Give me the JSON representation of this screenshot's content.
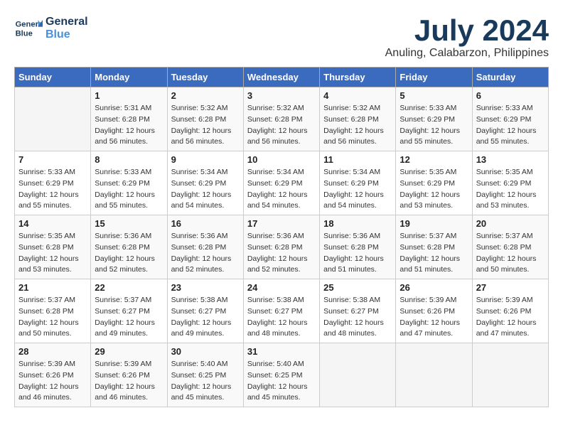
{
  "header": {
    "logo_line1": "General",
    "logo_line2": "Blue",
    "title": "July 2024",
    "subtitle": "Anuling, Calabarzon, Philippines"
  },
  "calendar": {
    "days_of_week": [
      "Sunday",
      "Monday",
      "Tuesday",
      "Wednesday",
      "Thursday",
      "Friday",
      "Saturday"
    ],
    "weeks": [
      [
        {
          "day": "",
          "info": ""
        },
        {
          "day": "1",
          "info": "Sunrise: 5:31 AM\nSunset: 6:28 PM\nDaylight: 12 hours\nand 56 minutes."
        },
        {
          "day": "2",
          "info": "Sunrise: 5:32 AM\nSunset: 6:28 PM\nDaylight: 12 hours\nand 56 minutes."
        },
        {
          "day": "3",
          "info": "Sunrise: 5:32 AM\nSunset: 6:28 PM\nDaylight: 12 hours\nand 56 minutes."
        },
        {
          "day": "4",
          "info": "Sunrise: 5:32 AM\nSunset: 6:28 PM\nDaylight: 12 hours\nand 56 minutes."
        },
        {
          "day": "5",
          "info": "Sunrise: 5:33 AM\nSunset: 6:29 PM\nDaylight: 12 hours\nand 55 minutes."
        },
        {
          "day": "6",
          "info": "Sunrise: 5:33 AM\nSunset: 6:29 PM\nDaylight: 12 hours\nand 55 minutes."
        }
      ],
      [
        {
          "day": "7",
          "info": "Sunrise: 5:33 AM\nSunset: 6:29 PM\nDaylight: 12 hours\nand 55 minutes."
        },
        {
          "day": "8",
          "info": "Sunrise: 5:33 AM\nSunset: 6:29 PM\nDaylight: 12 hours\nand 55 minutes."
        },
        {
          "day": "9",
          "info": "Sunrise: 5:34 AM\nSunset: 6:29 PM\nDaylight: 12 hours\nand 54 minutes."
        },
        {
          "day": "10",
          "info": "Sunrise: 5:34 AM\nSunset: 6:29 PM\nDaylight: 12 hours\nand 54 minutes."
        },
        {
          "day": "11",
          "info": "Sunrise: 5:34 AM\nSunset: 6:29 PM\nDaylight: 12 hours\nand 54 minutes."
        },
        {
          "day": "12",
          "info": "Sunrise: 5:35 AM\nSunset: 6:29 PM\nDaylight: 12 hours\nand 53 minutes."
        },
        {
          "day": "13",
          "info": "Sunrise: 5:35 AM\nSunset: 6:29 PM\nDaylight: 12 hours\nand 53 minutes."
        }
      ],
      [
        {
          "day": "14",
          "info": "Sunrise: 5:35 AM\nSunset: 6:28 PM\nDaylight: 12 hours\nand 53 minutes."
        },
        {
          "day": "15",
          "info": "Sunrise: 5:36 AM\nSunset: 6:28 PM\nDaylight: 12 hours\nand 52 minutes."
        },
        {
          "day": "16",
          "info": "Sunrise: 5:36 AM\nSunset: 6:28 PM\nDaylight: 12 hours\nand 52 minutes."
        },
        {
          "day": "17",
          "info": "Sunrise: 5:36 AM\nSunset: 6:28 PM\nDaylight: 12 hours\nand 52 minutes."
        },
        {
          "day": "18",
          "info": "Sunrise: 5:36 AM\nSunset: 6:28 PM\nDaylight: 12 hours\nand 51 minutes."
        },
        {
          "day": "19",
          "info": "Sunrise: 5:37 AM\nSunset: 6:28 PM\nDaylight: 12 hours\nand 51 minutes."
        },
        {
          "day": "20",
          "info": "Sunrise: 5:37 AM\nSunset: 6:28 PM\nDaylight: 12 hours\nand 50 minutes."
        }
      ],
      [
        {
          "day": "21",
          "info": "Sunrise: 5:37 AM\nSunset: 6:28 PM\nDaylight: 12 hours\nand 50 minutes."
        },
        {
          "day": "22",
          "info": "Sunrise: 5:37 AM\nSunset: 6:27 PM\nDaylight: 12 hours\nand 49 minutes."
        },
        {
          "day": "23",
          "info": "Sunrise: 5:38 AM\nSunset: 6:27 PM\nDaylight: 12 hours\nand 49 minutes."
        },
        {
          "day": "24",
          "info": "Sunrise: 5:38 AM\nSunset: 6:27 PM\nDaylight: 12 hours\nand 48 minutes."
        },
        {
          "day": "25",
          "info": "Sunrise: 5:38 AM\nSunset: 6:27 PM\nDaylight: 12 hours\nand 48 minutes."
        },
        {
          "day": "26",
          "info": "Sunrise: 5:39 AM\nSunset: 6:26 PM\nDaylight: 12 hours\nand 47 minutes."
        },
        {
          "day": "27",
          "info": "Sunrise: 5:39 AM\nSunset: 6:26 PM\nDaylight: 12 hours\nand 47 minutes."
        }
      ],
      [
        {
          "day": "28",
          "info": "Sunrise: 5:39 AM\nSunset: 6:26 PM\nDaylight: 12 hours\nand 46 minutes."
        },
        {
          "day": "29",
          "info": "Sunrise: 5:39 AM\nSunset: 6:26 PM\nDaylight: 12 hours\nand 46 minutes."
        },
        {
          "day": "30",
          "info": "Sunrise: 5:40 AM\nSunset: 6:25 PM\nDaylight: 12 hours\nand 45 minutes."
        },
        {
          "day": "31",
          "info": "Sunrise: 5:40 AM\nSunset: 6:25 PM\nDaylight: 12 hours\nand 45 minutes."
        },
        {
          "day": "",
          "info": ""
        },
        {
          "day": "",
          "info": ""
        },
        {
          "day": "",
          "info": ""
        }
      ]
    ]
  }
}
